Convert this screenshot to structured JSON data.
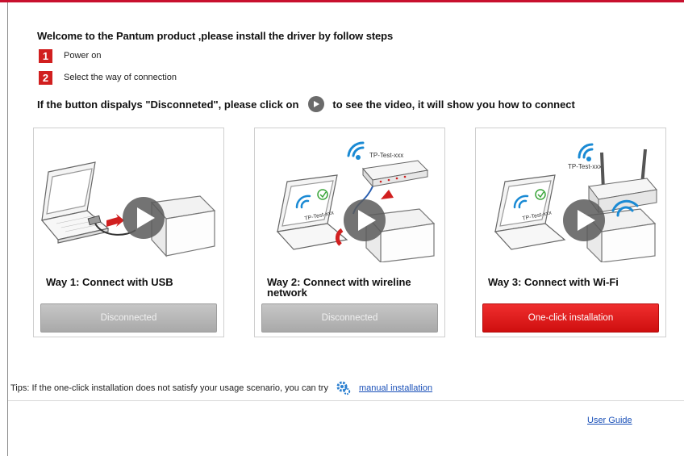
{
  "colors": {
    "brand_red": "#c8102e",
    "button_red": "#e21b1b",
    "button_gray": "#b3b3b3",
    "link_blue": "#1a50b8"
  },
  "welcome": "Welcome to the Pantum product ,please install the driver by follow steps",
  "steps": [
    {
      "number": "1",
      "label": "Power on"
    },
    {
      "number": "2",
      "label": "Select the way of connection"
    }
  ],
  "hint": {
    "before": "If the button dispalys \"Disconneted\", please click on",
    "icon": "play-icon",
    "after": "to see the video, it will show you how to connect"
  },
  "ways": [
    {
      "title": "Way 1: Connect with USB",
      "button": "Disconnected",
      "button_state": "disabled",
      "illustration": "laptop-usb-printer"
    },
    {
      "title": "Way 2: Connect with wireline network",
      "button": "Disconnected",
      "button_state": "disabled",
      "illustration": "laptop-router-printer",
      "ssid_label": "TP-Test-xxx",
      "laptop_label": "TP-Test-xxx"
    },
    {
      "title": "Way 3: Connect with Wi-Fi",
      "button": "One-click installation",
      "button_state": "active",
      "illustration": "laptop-wifi-printer",
      "ssid_label": "TP-Test-xxx",
      "laptop_label": "TP-Test-xxx"
    }
  ],
  "tips": {
    "text": "Tips: If the one-click installation does not satisfy your usage scenario, you can try",
    "icon": "gear-icon",
    "link": "manual installation"
  },
  "user_guide": "User Guide"
}
